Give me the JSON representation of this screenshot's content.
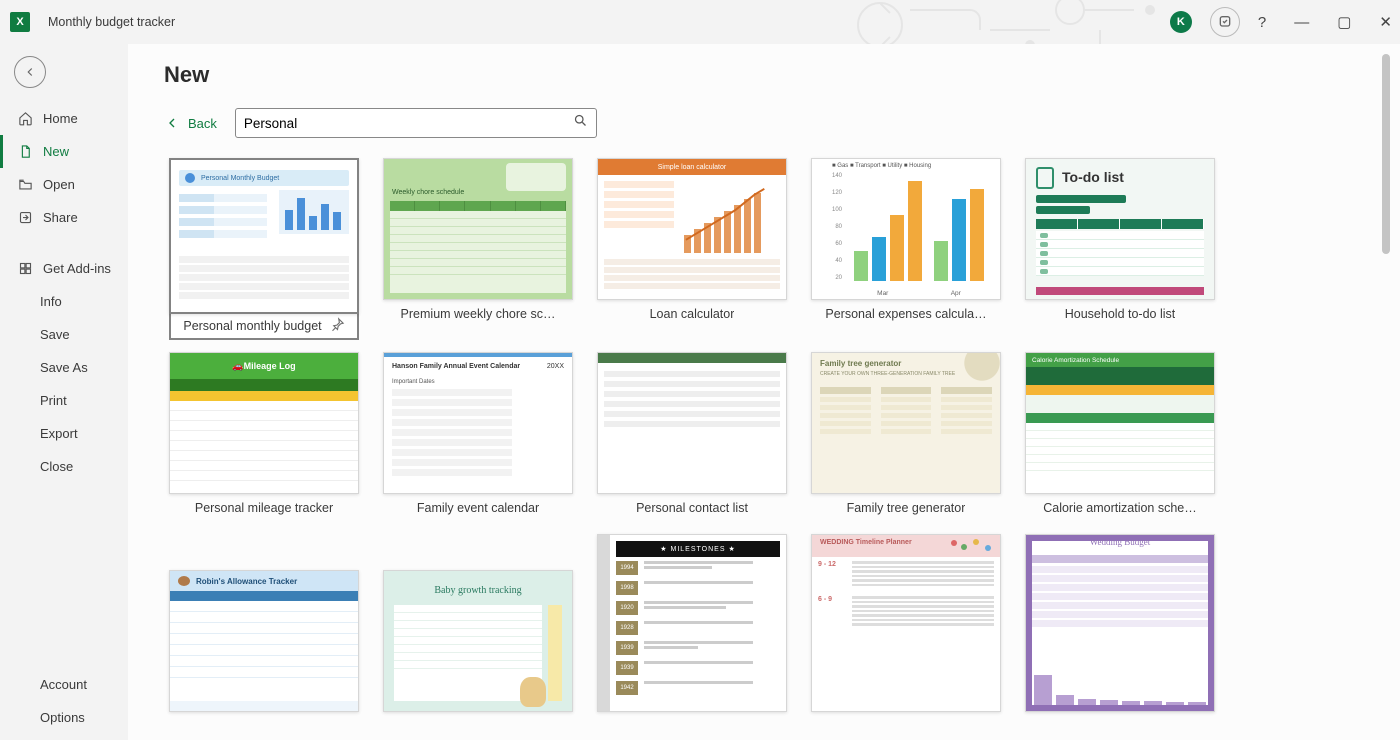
{
  "titlebar": {
    "doc_title": "Monthly budget tracker",
    "avatar_letter": "K",
    "help_symbol": "?"
  },
  "sidebar": {
    "items": [
      {
        "label": "Home"
      },
      {
        "label": "New"
      },
      {
        "label": "Open"
      },
      {
        "label": "Share"
      },
      {
        "label": "Get Add-ins"
      }
    ],
    "file_items": [
      {
        "label": "Info"
      },
      {
        "label": "Save"
      },
      {
        "label": "Save As"
      },
      {
        "label": "Print"
      },
      {
        "label": "Export"
      },
      {
        "label": "Close"
      }
    ],
    "bottom_items": [
      {
        "label": "Account"
      },
      {
        "label": "Options"
      }
    ]
  },
  "main": {
    "page_title": "New",
    "back_label": "Back",
    "search_value": "Personal"
  },
  "templates": [
    {
      "label": "Personal monthly budget",
      "selected": true,
      "pinnable": true
    },
    {
      "label": "Premium weekly chore sc…"
    },
    {
      "label": "Loan calculator"
    },
    {
      "label": "Personal expenses calcula…"
    },
    {
      "label": "Household to-do list"
    },
    {
      "label": "Personal mileage tracker"
    },
    {
      "label": "Family event calendar"
    },
    {
      "label": "Personal contact list"
    },
    {
      "label": "Family tree generator"
    },
    {
      "label": "Calorie amortization sche…"
    },
    {
      "label": ""
    },
    {
      "label": ""
    },
    {
      "label": ""
    },
    {
      "label": ""
    },
    {
      "label": ""
    }
  ],
  "thumb_text": {
    "loan_title": "Simple loan calculator",
    "todo_title": "To-do list",
    "mileage_title": "Mileage Log",
    "family_event_title": "Hanson Family Annual Event Calendar",
    "family_event_year": "20XX",
    "family_event_sub": "Important Dates",
    "family_tree_title": "Family tree generator",
    "calorie_title": "Calorie Amortization Schedule",
    "allowance_title": "Robin's Allowance Tracker",
    "baby_title": "Baby growth tracking",
    "milestones_title": "★  MILESTONES  ★",
    "wedding_tl_title": "WEDDING Timeline Planner",
    "wedding_budget_title": "Wedding Budget",
    "chore_title": "Weekly chore schedule",
    "exp_legend": "■ Gas  ■ Transport  ■ Utility  ■ Housing",
    "exp_month1": "Mar",
    "exp_month2": "Apr"
  }
}
